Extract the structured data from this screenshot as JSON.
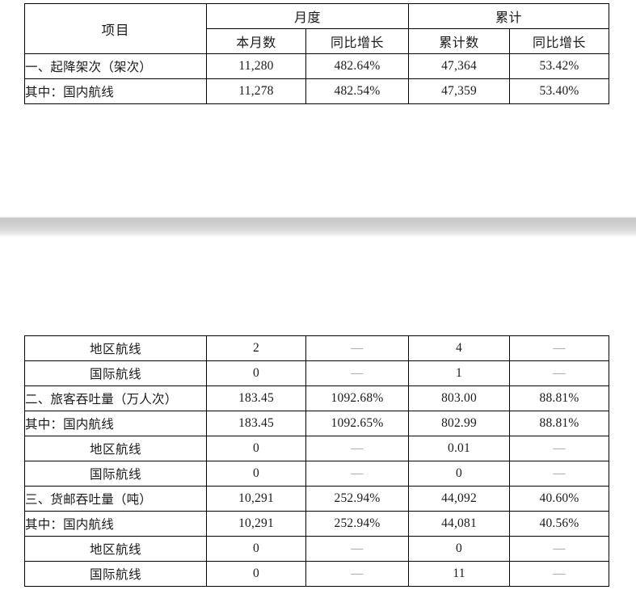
{
  "document": {
    "type": "airport-traffic-statistics-table",
    "language": "zh-CN"
  },
  "table1": {
    "headers": {
      "item": "项目",
      "monthly_group": "月度",
      "cumulative_group": "累计",
      "monthly_value": "本月数",
      "monthly_growth": "同比增长",
      "cumulative_value": "累计数",
      "cumulative_growth": "同比增长"
    },
    "rows": [
      {
        "label": "一、起降架次（架次）",
        "align": "left",
        "monthly_value": "11,280",
        "monthly_growth": "482.64%",
        "cumulative_value": "47,364",
        "cumulative_growth": "53.42%"
      },
      {
        "label": "其中：国内航线",
        "align": "left",
        "monthly_value": "11,278",
        "monthly_growth": "482.54%",
        "cumulative_value": "47,359",
        "cumulative_growth": "53.40%"
      }
    ]
  },
  "table2": {
    "rows": [
      {
        "label": "地区航线",
        "align": "center",
        "monthly_value": "2",
        "monthly_growth": "—",
        "cumulative_value": "4",
        "cumulative_growth": "—"
      },
      {
        "label": "国际航线",
        "align": "center",
        "monthly_value": "0",
        "monthly_growth": "—",
        "cumulative_value": "1",
        "cumulative_growth": "—"
      },
      {
        "label": "二、旅客吞吐量（万人次）",
        "align": "left",
        "monthly_value": "183.45",
        "monthly_growth": "1092.68%",
        "cumulative_value": "803.00",
        "cumulative_growth": "88.81%"
      },
      {
        "label": "其中：国内航线",
        "align": "left",
        "monthly_value": "183.45",
        "monthly_growth": "1092.65%",
        "cumulative_value": "802.99",
        "cumulative_growth": "88.81%"
      },
      {
        "label": "地区航线",
        "align": "center",
        "monthly_value": "0",
        "monthly_growth": "—",
        "cumulative_value": "0.01",
        "cumulative_growth": "—"
      },
      {
        "label": "国际航线",
        "align": "center",
        "monthly_value": "0",
        "monthly_growth": "—",
        "cumulative_value": "0",
        "cumulative_growth": "—"
      },
      {
        "label": "三、货邮吞吐量（吨）",
        "align": "left",
        "monthly_value": "10,291",
        "monthly_growth": "252.94%",
        "cumulative_value": "44,092",
        "cumulative_growth": "40.60%"
      },
      {
        "label": "其中：国内航线",
        "align": "left",
        "monthly_value": "10,291",
        "monthly_growth": "252.94%",
        "cumulative_value": "44,081",
        "cumulative_growth": "40.56%"
      },
      {
        "label": "地区航线",
        "align": "center",
        "monthly_value": "0",
        "monthly_growth": "—",
        "cumulative_value": "0",
        "cumulative_growth": "—"
      },
      {
        "label": "国际航线",
        "align": "center",
        "monthly_value": "0",
        "monthly_growth": "—",
        "cumulative_value": "11",
        "cumulative_growth": "—"
      }
    ]
  }
}
